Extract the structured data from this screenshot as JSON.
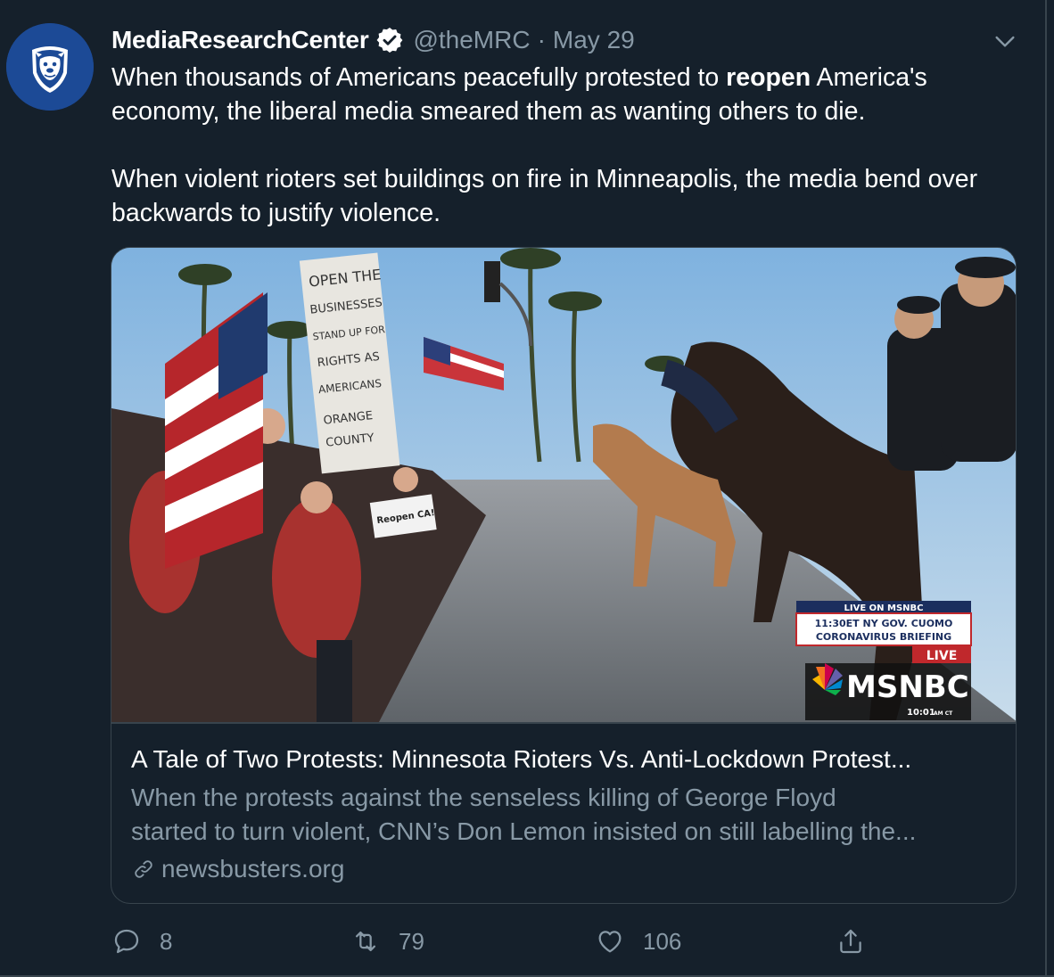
{
  "tweet": {
    "display_name": "MediaResearchCenter",
    "handle": "@theMRC",
    "separator": "·",
    "date": "May 29",
    "text_line1_before": "When thousands of Americans peacefully protested to ",
    "text_line1_bold": "reopen",
    "text_line1_after": " America's economy, the liberal media smeared them as wanting others to die.",
    "text_paragraph2": "When violent rioters set buildings on fire in Minneapolis, the media bend over backwards to justify violence."
  },
  "card": {
    "title": "A Tale of Two Protests: Minnesota Rioters Vs. Anti-Lockdown Protest...",
    "description_line1": "When the protests against the senseless killing of George Floyd",
    "description_line2": "started to turn violent, CNN’s Don Lemon insisted on still labelling the...",
    "domain": "newsbusters.org",
    "image": {
      "sign_text": [
        "OPEN THE",
        "BUSINESSES",
        "STAND UP FOR",
        "RIGHTS AS",
        "AMERICANS",
        "ORANGE",
        "COUNTY"
      ],
      "small_sign": "Reopen CA!",
      "msnbc": {
        "live_header": "LIVE ON MSNBC",
        "line1": "11:30ET NY GOV. CUOMO",
        "line2": "CORONAVIRUS BRIEFING",
        "live": "LIVE",
        "brand": "MSNBC",
        "time": "10:01",
        "time_suffix": "AM CT"
      }
    }
  },
  "actions": {
    "replies": "8",
    "retweets": "79",
    "likes": "106"
  },
  "colors": {
    "background": "#15202b",
    "border": "#38444d",
    "secondary_text": "#8899a6",
    "avatar_blue": "#1c4a96"
  },
  "icons": [
    "mrc-bulldog-logo",
    "verified-badge-icon",
    "chevron-down-icon",
    "link-icon",
    "reply-icon",
    "retweet-icon",
    "like-icon",
    "share-icon"
  ]
}
